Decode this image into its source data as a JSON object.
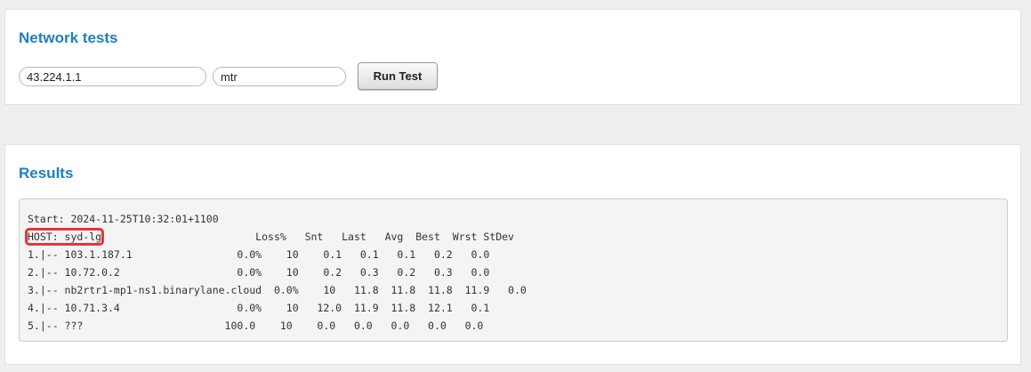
{
  "network_tests": {
    "title": "Network tests",
    "host_value": "43.224.1.1",
    "tool_value": "mtr",
    "run_button_label": "Run Test"
  },
  "results": {
    "title": "Results",
    "start_line": "Start: 2024-11-25T10:32:01+1100",
    "header_host": "HOST: syd-lg",
    "header_columns": "                         Loss%   Snt   Last   Avg  Best  Wrst StDev",
    "hops": [
      "1.|-- 103.1.187.1                 0.0%    10    0.1   0.1   0.1   0.2   0.0",
      "2.|-- 10.72.0.2                   0.0%    10    0.2   0.3   0.2   0.3   0.0",
      "3.|-- nb2rtr1-mp1-ns1.binarylane.cloud  0.0%    10   11.8  11.8  11.8  11.9   0.0",
      "4.|-- 10.71.3.4                   0.0%    10   12.0  11.9  11.8  12.1   0.1",
      "5.|-- ???                       100.0    10    0.0   0.0   0.0   0.0   0.0"
    ]
  },
  "colors": {
    "heading": "#1f7fbf",
    "highlight": "#e8353a"
  }
}
